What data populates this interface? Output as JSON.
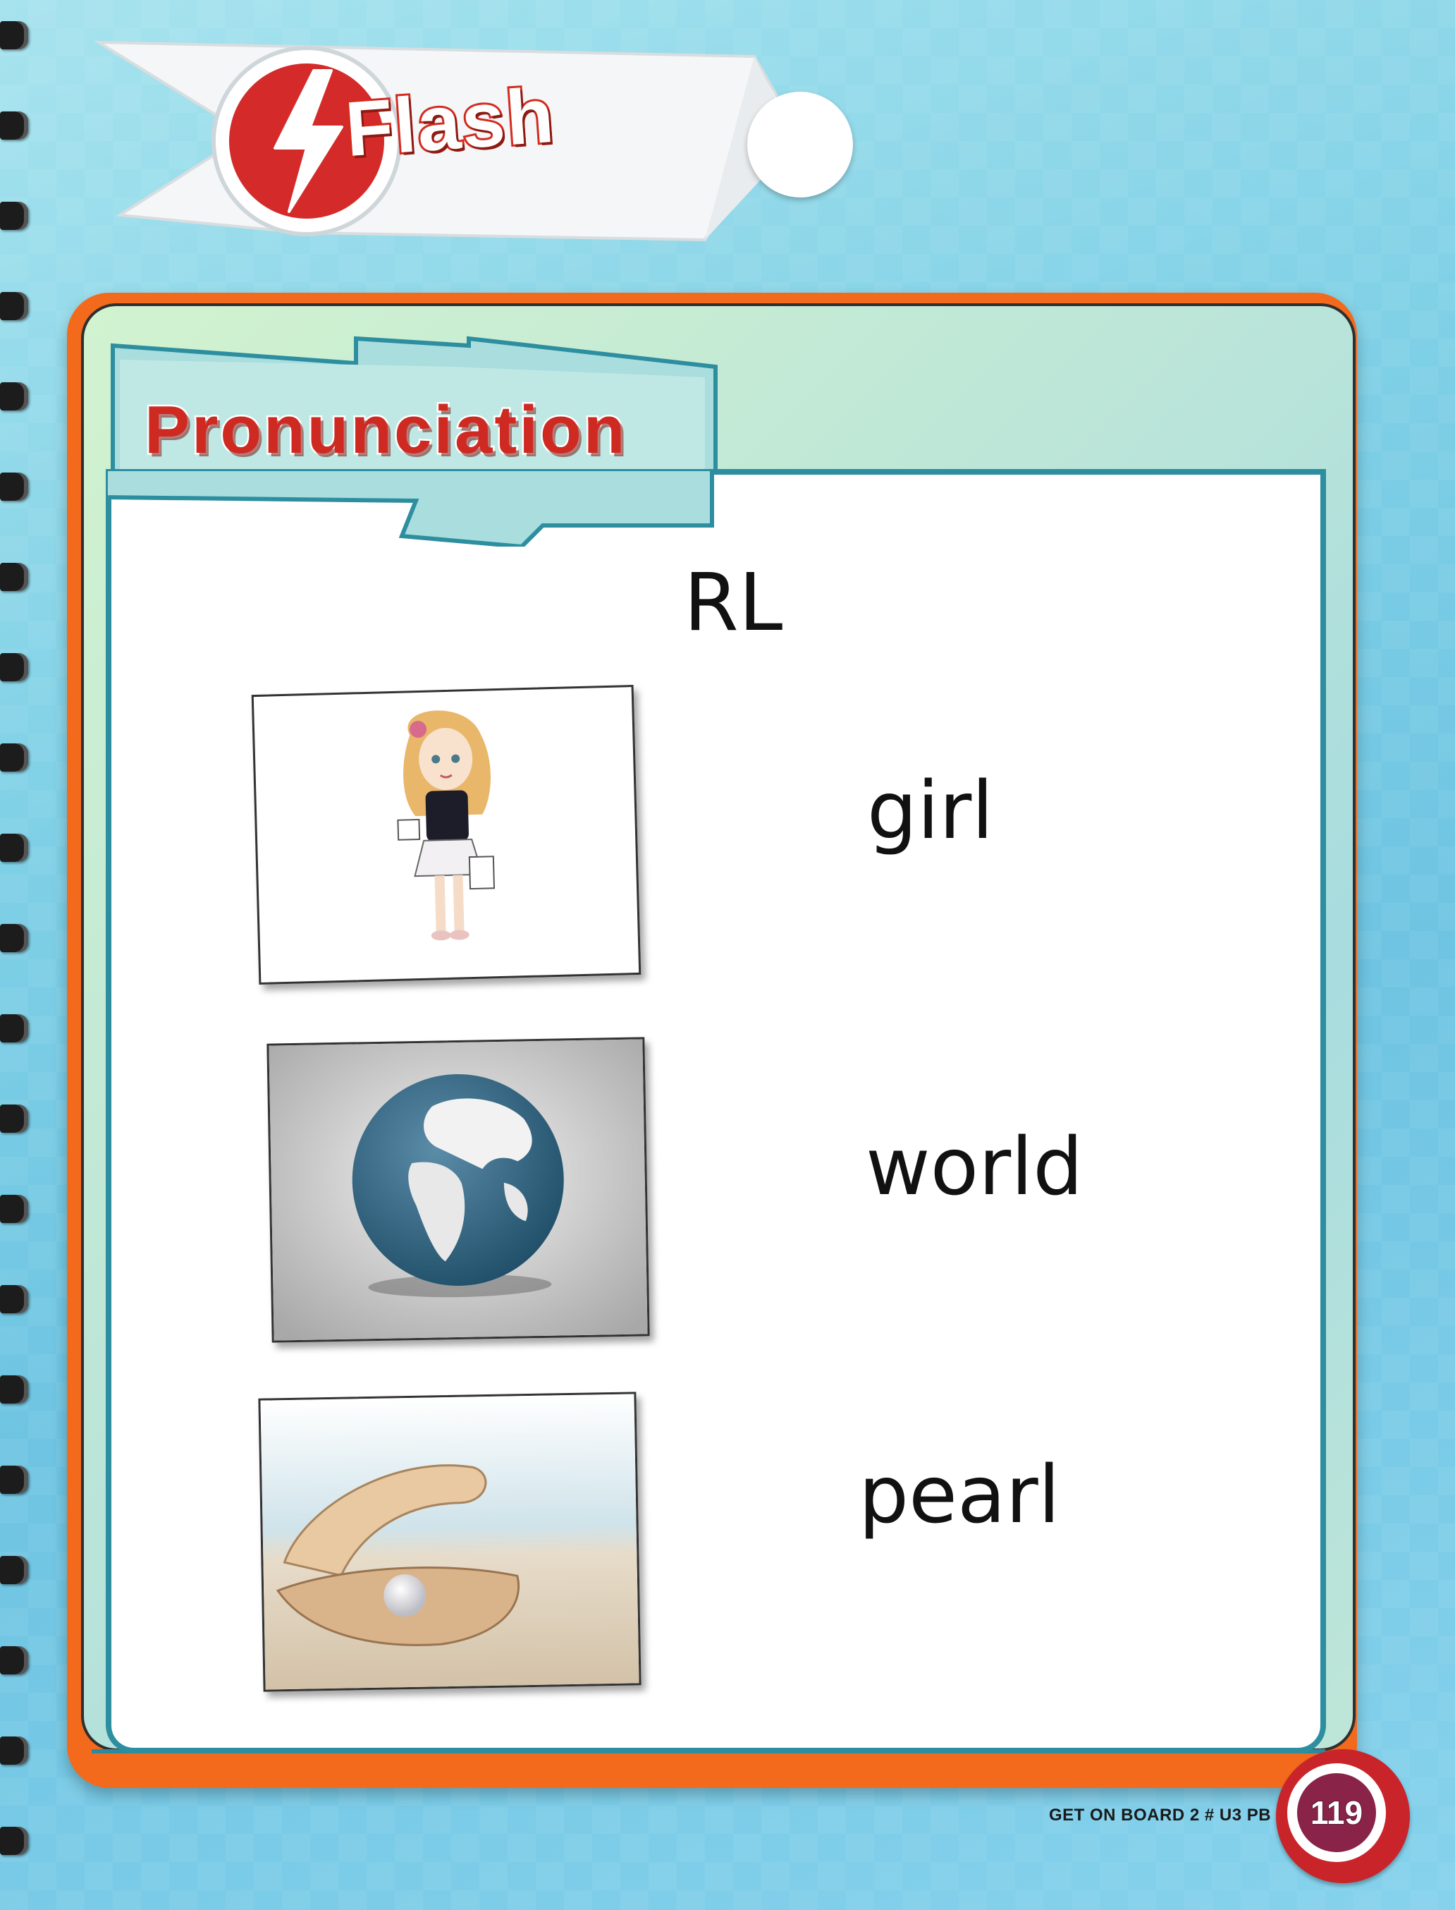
{
  "header": {
    "banner_title": "Flash",
    "icon": "lightning-bolt-icon"
  },
  "section": {
    "title": "Pronunciation",
    "sound": "RL"
  },
  "items": [
    {
      "word": "girl",
      "image": "girl-illustration"
    },
    {
      "word": "world",
      "image": "globe-photo"
    },
    {
      "word": "pearl",
      "image": "pearl-in-shell-photo"
    }
  ],
  "footer": {
    "book_label": "GET ON BOARD 2 # U3 PB",
    "page_number": "119"
  },
  "colors": {
    "accent_red": "#d42b1f",
    "frame_orange": "#f36a1d",
    "frame_teal": "#2d8ea0",
    "page_blue": "#7fd0e6"
  }
}
